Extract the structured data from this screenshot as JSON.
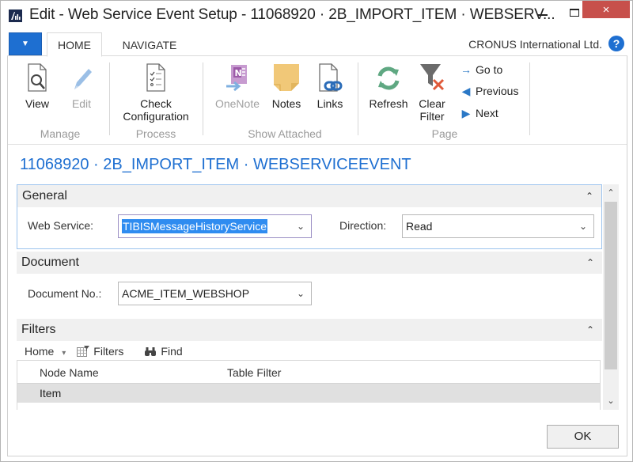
{
  "window": {
    "title": "Edit - Web Service Event Setup - 11068920 · 2B_IMPORT_ITEM · WEBSERV...",
    "app_icon": "dynamics-nav-logo-icon",
    "controls": {
      "minimize": "minimize-icon",
      "maximize": "maximize-icon",
      "close": "×"
    }
  },
  "ribbon": {
    "app_menu_glyph": "▼",
    "tabs": [
      {
        "label": "HOME",
        "active": true
      },
      {
        "label": "NAVIGATE",
        "active": false
      }
    ],
    "company": "CRONUS International Ltd.",
    "help_glyph": "?",
    "groups": [
      {
        "label": "Manage",
        "buttons": [
          {
            "label": "View",
            "icon": "view-document-icon",
            "enabled": true
          },
          {
            "label": "Edit",
            "icon": "pencil-icon",
            "enabled": false
          }
        ]
      },
      {
        "label": "Process",
        "buttons": [
          {
            "label": "Check Configuration",
            "line1": "Check",
            "line2": "Configuration",
            "icon": "checklist-document-icon",
            "enabled": true
          }
        ]
      },
      {
        "label": "Show Attached",
        "buttons": [
          {
            "label": "OneNote",
            "icon": "onenote-icon",
            "enabled": false
          },
          {
            "label": "Notes",
            "icon": "sticky-note-icon",
            "enabled": true
          },
          {
            "label": "Links",
            "icon": "links-document-icon",
            "enabled": true
          }
        ]
      },
      {
        "label": "Page",
        "buttons": [
          {
            "label": "Refresh",
            "icon": "refresh-icon",
            "enabled": true
          },
          {
            "label": "Clear Filter",
            "line1": "Clear",
            "line2": "Filter",
            "icon": "clear-filter-icon",
            "enabled": true
          }
        ],
        "small_buttons": [
          {
            "label": "Go to",
            "icon": "arrow-right-icon",
            "glyph": "→"
          },
          {
            "label": "Previous",
            "icon": "triangle-left-icon",
            "glyph": "◀"
          },
          {
            "label": "Next",
            "icon": "triangle-right-icon",
            "glyph": "▶"
          }
        ]
      }
    ]
  },
  "page": {
    "record_title": "11068920 · 2B_IMPORT_ITEM · WEBSERVICEEVENT",
    "sections": {
      "general": {
        "title": "General",
        "collapse_glyph": "⌃",
        "web_service_label": "Web Service:",
        "web_service_value": "TIBISMessageHistoryService",
        "direction_label": "Direction:",
        "direction_value": "Read"
      },
      "document": {
        "title": "Document",
        "collapse_glyph": "⌃",
        "document_no_label": "Document No.:",
        "document_no_value": "ACME_ITEM_WEBSHOP"
      },
      "filters": {
        "title": "Filters",
        "collapse_glyph": "⌃",
        "toolbar": {
          "home_label": "Home",
          "home_dropdown_glyph": "▾",
          "filters_label": "Filters",
          "find_label": "Find"
        },
        "columns": [
          "Node Name",
          "Table Filter"
        ],
        "rows": [
          {
            "node_name": "Item",
            "table_filter": ""
          }
        ]
      }
    },
    "dropdown_glyph": "⌄"
  },
  "scrollbar": {
    "up_glyph": "⌃",
    "down_glyph": "⌄"
  },
  "footer": {
    "ok_label": "OK"
  },
  "colors": {
    "accent": "#1e6fd1",
    "close_button": "#c7504b",
    "selection": "#2f8cf0",
    "focus_border": "#9cc3ee",
    "section_header_bg": "#f0f0f0",
    "selected_row_bg": "#e0e0e0"
  }
}
